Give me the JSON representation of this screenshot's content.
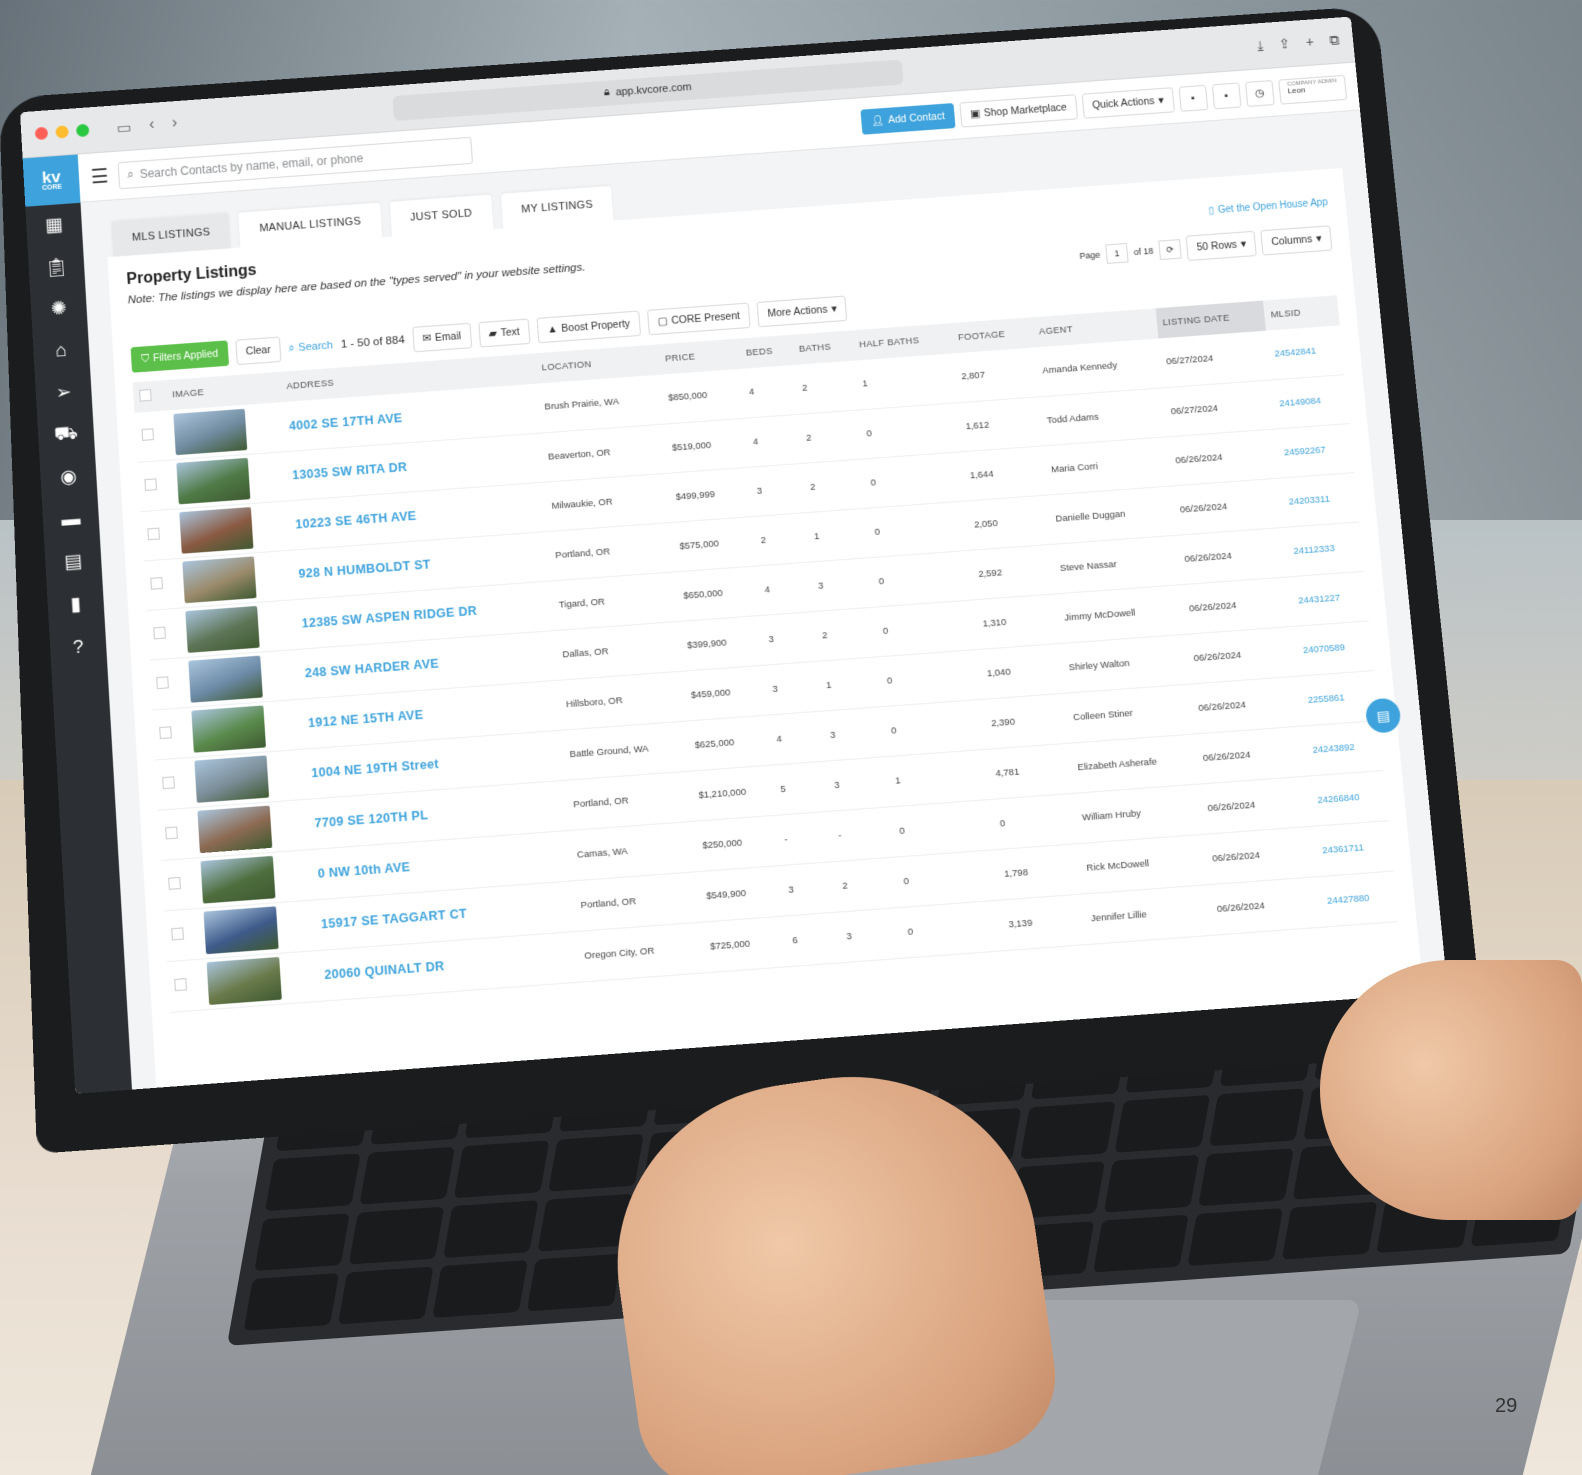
{
  "browser": {
    "url": "app.kvcore.com"
  },
  "logo": {
    "main": "kv",
    "sub": "CORE"
  },
  "topbar": {
    "search_placeholder": "Search Contacts by name, email, or phone",
    "add_contact": "Add Contact",
    "shop_marketplace": "Shop Marketplace",
    "quick_actions": "Quick Actions",
    "admin_role": "COMPANY ADMIN",
    "admin_name": "Leon"
  },
  "tabs": [
    "MLS LISTINGS",
    "MANUAL LISTINGS",
    "JUST SOLD",
    "MY LISTINGS"
  ],
  "card": {
    "title": "Property Listings",
    "note": "Note: The listings we display here are based on the \"types served\" in your website settings.",
    "open_house": "Get the Open House App"
  },
  "pager": {
    "page_label": "Page",
    "page": "1",
    "of": "of 18",
    "rows": "50 Rows",
    "columns": "Columns"
  },
  "toolbar": {
    "filters": "Filters Applied",
    "clear": "Clear",
    "search": "Search",
    "count": "1 - 50 of 884",
    "email": "Email",
    "text": "Text",
    "boost": "Boost Property",
    "core_present": "CORE Present",
    "more_actions": "More Actions"
  },
  "table": {
    "headers": [
      "IMAGE",
      "ADDRESS",
      "LOCATION",
      "PRICE",
      "BEDS",
      "BATHS",
      "HALF BATHS",
      "FOOTAGE",
      "AGENT",
      "LISTING DATE",
      "MLSID"
    ],
    "rows": [
      {
        "address": "4002 SE 17TH AVE",
        "location": "Brush Prairie, WA",
        "price": "$850,000",
        "beds": "4",
        "baths": "2",
        "half": "1",
        "footage": "2,807",
        "agent": "Amanda Kennedy",
        "date": "06/27/2024",
        "mlsid": "24542841",
        "img": "#6f8a9e"
      },
      {
        "address": "13035 SW RITA DR",
        "location": "Beaverton, OR",
        "price": "$519,000",
        "beds": "4",
        "baths": "2",
        "half": "0",
        "footage": "1,612",
        "agent": "Todd Adams",
        "date": "06/27/2024",
        "mlsid": "24149084",
        "img": "#4f7a46"
      },
      {
        "address": "10223 SE 46TH AVE",
        "location": "Milwaukie, OR",
        "price": "$499,999",
        "beds": "3",
        "baths": "2",
        "half": "0",
        "footage": "1,644",
        "agent": "Maria Corri",
        "date": "06/26/2024",
        "mlsid": "24592267",
        "img": "#8a5a42"
      },
      {
        "address": "928 N HUMBOLDT ST",
        "location": "Portland, OR",
        "price": "$575,000",
        "beds": "2",
        "baths": "1",
        "half": "0",
        "footage": "2,050",
        "agent": "Danielle Duggan",
        "date": "06/26/2024",
        "mlsid": "24203311",
        "img": "#9a8a6a"
      },
      {
        "address": "12385 SW ASPEN RIDGE DR",
        "location": "Tigard, OR",
        "price": "$650,000",
        "beds": "4",
        "baths": "3",
        "half": "0",
        "footage": "2,592",
        "agent": "Steve Nassar",
        "date": "06/26/2024",
        "mlsid": "24112333",
        "img": "#5d7456"
      },
      {
        "address": "248 SW HARDER AVE",
        "location": "Dallas, OR",
        "price": "$399,900",
        "beds": "3",
        "baths": "2",
        "half": "0",
        "footage": "1,310",
        "agent": "Jimmy McDowell",
        "date": "06/26/2024",
        "mlsid": "24431227",
        "img": "#6c8aa6"
      },
      {
        "address": "1912 NE 15TH AVE",
        "location": "Hillsboro, OR",
        "price": "$459,000",
        "beds": "3",
        "baths": "1",
        "half": "0",
        "footage": "1,040",
        "agent": "Shirley Walton",
        "date": "06/26/2024",
        "mlsid": "24070589",
        "img": "#5a8a4c"
      },
      {
        "address": "1004 NE 19TH Street",
        "location": "Battle Ground, WA",
        "price": "$625,000",
        "beds": "4",
        "baths": "3",
        "half": "0",
        "footage": "2,390",
        "agent": "Colleen Stiner",
        "date": "06/26/2024",
        "mlsid": "2255861",
        "img": "#7a8c96"
      },
      {
        "address": "7709 SE 120TH PL",
        "location": "Portland, OR",
        "price": "$1,210,000",
        "beds": "5",
        "baths": "3",
        "half": "1",
        "footage": "4,781",
        "agent": "Elizabeth Asherafe",
        "date": "06/26/2024",
        "mlsid": "24243892",
        "img": "#8c6a52"
      },
      {
        "address": "0 NW 10th AVE",
        "location": "Camas, WA",
        "price": "$250,000",
        "beds": "-",
        "baths": "-",
        "half": "0",
        "footage": "0",
        "agent": "William Hruby",
        "date": "06/26/2024",
        "mlsid": "24266840",
        "img": "#4e6e3e"
      },
      {
        "address": "15917 SE TAGGART CT",
        "location": "Portland, OR",
        "price": "$549,900",
        "beds": "3",
        "baths": "2",
        "half": "0",
        "footage": "1,798",
        "agent": "Rick McDowell",
        "date": "06/26/2024",
        "mlsid": "24361711",
        "img": "#3e5a8a"
      },
      {
        "address": "20060 QUINALT DR",
        "location": "Oregon City, OR",
        "price": "$725,000",
        "beds": "6",
        "baths": "3",
        "half": "0",
        "footage": "3,139",
        "agent": "Jennifer Lillie",
        "date": "06/26/2024",
        "mlsid": "24427880",
        "img": "#6a7a4a"
      }
    ]
  },
  "page_number": "29"
}
